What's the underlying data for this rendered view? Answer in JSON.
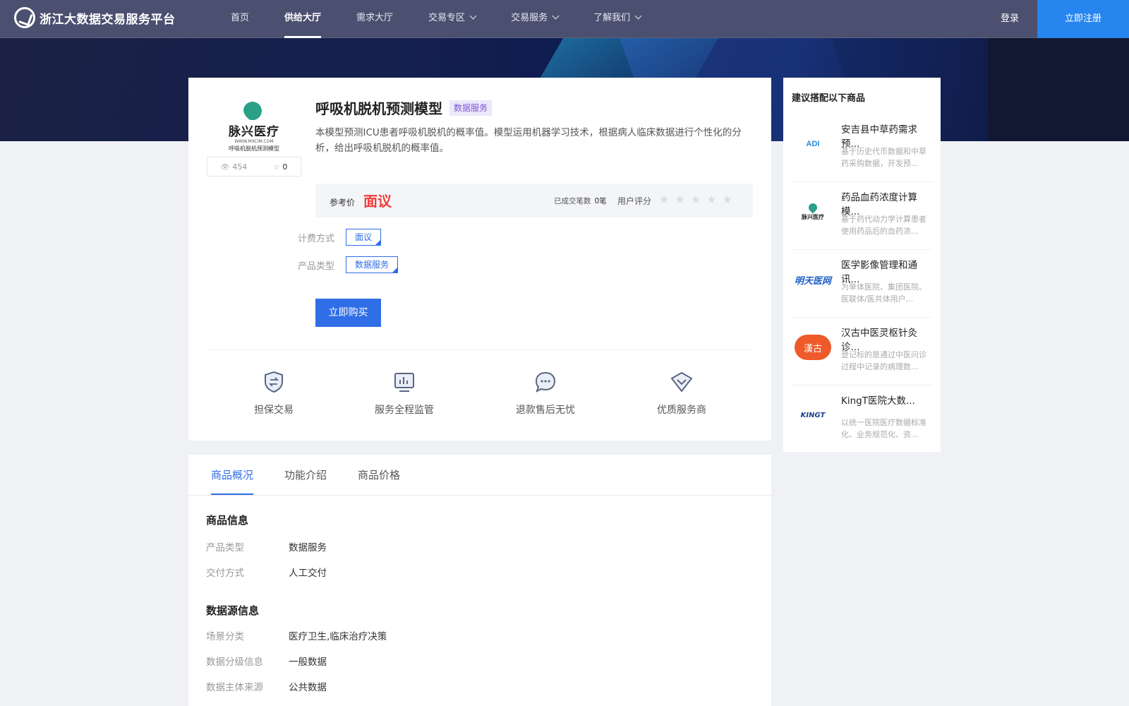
{
  "header": {
    "logo_text": "浙江大数据交易服务平台",
    "nav": [
      {
        "label": "首页",
        "active": false,
        "dropdown": false
      },
      {
        "label": "供给大厅",
        "active": true,
        "dropdown": false
      },
      {
        "label": "需求大厅",
        "active": false,
        "dropdown": false
      },
      {
        "label": "交易专区",
        "active": false,
        "dropdown": true
      },
      {
        "label": "交易服务",
        "active": false,
        "dropdown": true
      },
      {
        "label": "了解我们",
        "active": false,
        "dropdown": true
      }
    ],
    "login": "登录",
    "register": "立即注册"
  },
  "product": {
    "logo_brand": "脉兴医疗",
    "logo_url": "WWW.MXCIM.COM",
    "logo_sub": "呼吸机脱机预测模型",
    "views": "454",
    "favorites": "0",
    "title": "呼吸机脱机预测模型",
    "tag": "数据服务",
    "description": "本模型预测ICU患者呼吸机脱机的概率值。模型运用机器学习技术，根据病人临床数据进行个性化的分析，给出呼吸机脱机的概率值。",
    "price_label": "参考价",
    "price_value": "面议",
    "deals_label": "已成交笔数",
    "deals_value": "0笔",
    "rating_label": "用户评分",
    "rating": 0,
    "billing_label": "计费方式",
    "billing_value": "面议",
    "type_label": "产品类型",
    "type_value": "数据服务",
    "buy_button": "立即购买",
    "features": [
      "担保交易",
      "服务全程监管",
      "退款售后无忧",
      "优质服务商"
    ]
  },
  "tabs": [
    "商品概况",
    "功能介绍",
    "商品价格"
  ],
  "details": {
    "section1_title": "商品信息",
    "section1": [
      {
        "key": "产品类型",
        "value": "数据服务"
      },
      {
        "key": "交付方式",
        "value": "人工交付"
      }
    ],
    "section2_title": "数据源信息",
    "section2": [
      {
        "key": "场景分类",
        "value": "医疗卫生,临床治疗决策"
      },
      {
        "key": "数据分级信息",
        "value": "一般数据"
      },
      {
        "key": "数据主体来源",
        "value": "公共数据"
      }
    ]
  },
  "recommend": {
    "title": "建议搭配以下商品",
    "items": [
      {
        "name": "安吉县中草药需求预...",
        "desc": "基于历史代币数据和中草药采购数据，开发预...",
        "logo": "ADI"
      },
      {
        "name": "药品血药浓度计算模...",
        "desc": "基于药代动力学计算患者使用药品后的血药浓...",
        "logo": "脉兴医疗"
      },
      {
        "name": "医学影像管理和通讯...",
        "desc": "为单体医院、集团医院、医联体/医共体用户...",
        "logo": "明天医网"
      },
      {
        "name": "汉古中医灵枢针灸诊...",
        "desc": "登记标的是通过中医问诊过程中记录的病理数...",
        "logo": "漢古"
      },
      {
        "name": "KingT医院大数...",
        "desc": "以统一医院医疗数据标准化、业务规范化、资...",
        "logo": "KINGT"
      }
    ]
  },
  "colors": {
    "primary": "#2f6ee6",
    "price": "#f03d3d",
    "header_bg": "#4b5070",
    "register_bg": "#2785ef",
    "tag_bg": "#ede8fb",
    "tag_fg": "#7a55d8"
  }
}
